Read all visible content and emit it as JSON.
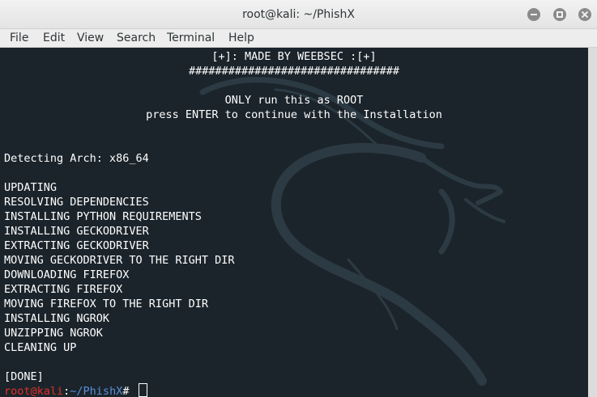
{
  "window": {
    "title": "root@kali: ~/PhishX"
  },
  "menu": {
    "items": [
      "File",
      "Edit",
      "View",
      "Search",
      "Terminal",
      "Help"
    ]
  },
  "terminal": {
    "header_lines": [
      "[+]: MADE BY WEEBSEC :[+]",
      "################################",
      "ONLY run this as ROOT",
      "press ENTER to continue with the Installation"
    ],
    "arch_line": "Detecting Arch: x86_64",
    "steps": [
      "UPDATING",
      "RESOLVING DEPENDENCIES",
      "INSTALLING PYTHON REQUIREMENTS",
      "INSTALLING GECKODRIVER",
      "EXTRACTING GECKODRIVER",
      "MOVING GECKODRIVER TO THE RIGHT DIR",
      "DOWNLOADING FIREFOX",
      "EXTRACTING FIREFOX",
      "MOVING FIREFOX TO THE RIGHT DIR",
      "INSTALLING NGROK",
      "UNZIPPING NGROK",
      "CLEANING UP"
    ],
    "done_line": "[DONE]",
    "prompt": {
      "user": "root@kali",
      "separator": ":",
      "path": "~/PhishX",
      "symbol": "# "
    }
  },
  "colors": {
    "terminal_bg": "#1b242b",
    "text": "#ffffff",
    "prompt_user": "#e0302a",
    "prompt_path": "#5a8fd8"
  },
  "icons": {
    "background": "kali-dragon-icon",
    "minimize": "minimize-icon",
    "maximize": "maximize-icon",
    "close": "close-icon"
  }
}
